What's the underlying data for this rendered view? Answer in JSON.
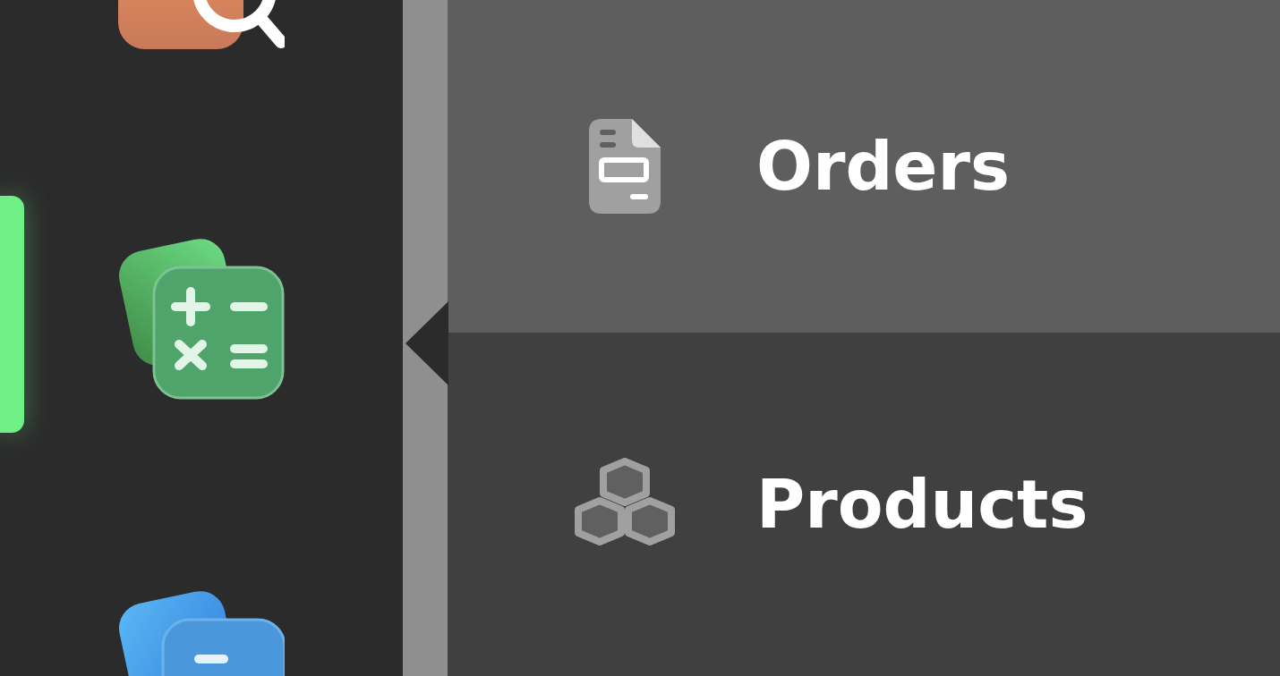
{
  "rail": {
    "apps": [
      {
        "kind": "search",
        "selected": false
      },
      {
        "kind": "calculator",
        "selected": true
      },
      {
        "kind": "minus",
        "selected": false
      }
    ]
  },
  "menu": {
    "items": [
      {
        "kind": "orders",
        "label": "Orders",
        "selected": true
      },
      {
        "kind": "products",
        "label": "Products",
        "selected": false
      }
    ]
  }
}
